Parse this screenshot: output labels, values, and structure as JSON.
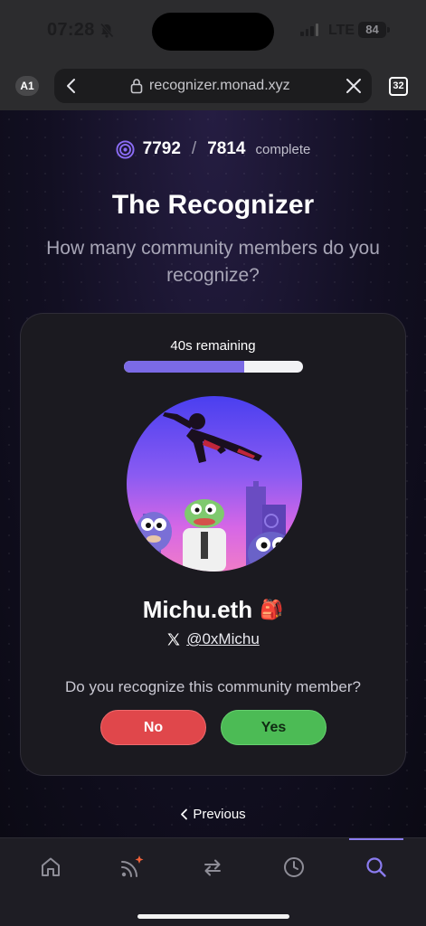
{
  "status_bar": {
    "time": "07:28",
    "network": "LTE",
    "battery": "84"
  },
  "browser": {
    "profile_badge": "A1",
    "url": "recognizer.monad.xyz",
    "tab_count": "32"
  },
  "progress": {
    "completed": "7792",
    "separator": "/",
    "total": "7814",
    "label": "complete"
  },
  "header": {
    "title": "The Recognizer",
    "subtitle": "How many community members do you recognize?"
  },
  "card": {
    "timer_text": "40s remaining",
    "timer_fraction": 0.67,
    "member_name": "Michu.eth",
    "member_emoji": "🎒",
    "member_handle": "@0xMichu",
    "question": "Do you recognize this community member?",
    "no_label": "No",
    "yes_label": "Yes"
  },
  "previous_label": "Previous",
  "nav": {
    "items": [
      {
        "icon": "home-icon",
        "active": false
      },
      {
        "icon": "feed-icon",
        "active": false
      },
      {
        "icon": "swap-icon",
        "active": false
      },
      {
        "icon": "history-icon",
        "active": false
      },
      {
        "icon": "search-icon",
        "active": true
      }
    ]
  },
  "colors": {
    "accent": "#7b6ae6",
    "no": "#e0474b",
    "yes": "#4cbb55",
    "notification_dot": "#f0623a"
  }
}
